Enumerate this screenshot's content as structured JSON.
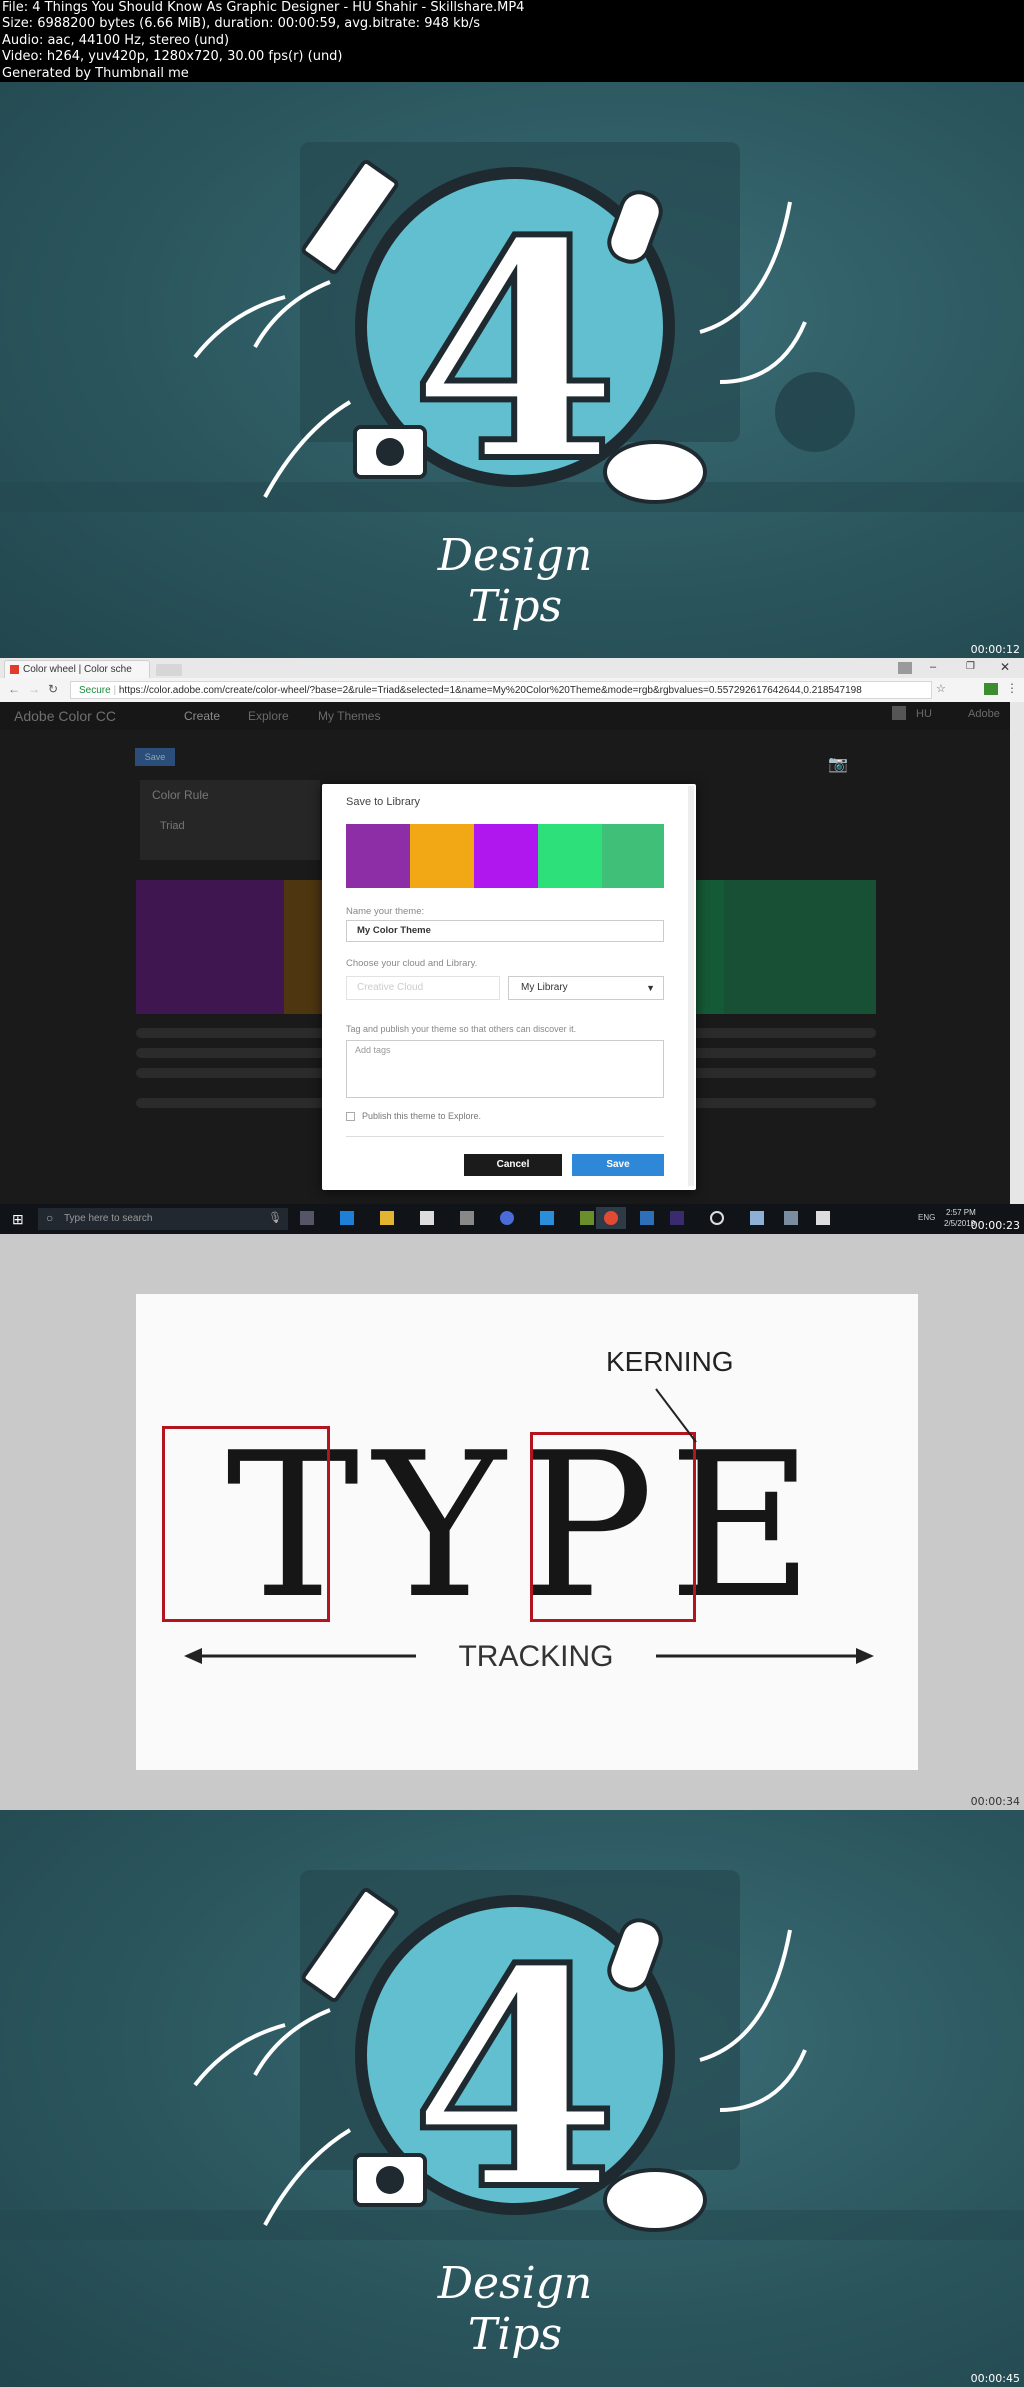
{
  "header": {
    "lines": [
      "File: 4 Things You Should Know As Graphic Designer - HU Shahir - Skillshare.MP4",
      "Size: 6988200 bytes (6.66 MiB), duration: 00:00:59, avg.bitrate: 948 kb/s",
      "Audio: aac, 44100 Hz, stereo (und)",
      "Video: h264, yuv420p, 1280x720, 30.00 fps(r) (und)",
      "Generated by Thumbnail me"
    ]
  },
  "frames": {
    "f1": {
      "numeral": "4",
      "caption": "Design Tips",
      "timestamp": "00:00:12"
    },
    "f2": {
      "tab_title": "Color wheel | Color sche",
      "secure_label": "Secure",
      "url": "https://color.adobe.com/create/color-wheel/?base=2&rule=Triad&selected=1&name=My%20Color%20Theme&mode=rgb&rgbvalues=0.557292617642644,0.218547198",
      "app_name": "Adobe Color CC",
      "nav": [
        "Create",
        "Explore",
        "My Themes"
      ],
      "user_label": "HU",
      "brand_label": "Adobe",
      "save_small": "Save",
      "color_rule_label": "Color Rule",
      "rule_value": "Triad",
      "modal": {
        "title": "Save to Library",
        "swatches": [
          "#8e2ea6",
          "#f2a814",
          "#b017ee",
          "#2ee07a",
          "#3fbf78"
        ],
        "name_label": "Name your theme:",
        "name_value": "My Color Theme",
        "cloud_label": "Choose your cloud and Library.",
        "cloud_value": "Creative Cloud",
        "library_value": "My Library",
        "tag_label": "Tag and publish your theme so that others can discover it.",
        "tag_placeholder": "Add tags",
        "publish_label": "Publish this theme to Explore.",
        "cancel": "Cancel",
        "save": "Save"
      },
      "search_placeholder": "Type here to search",
      "clock_time": "2:57 PM",
      "clock_date": "2/5/2019",
      "lang": "ENG",
      "timestamp": "00:00:23"
    },
    "f3": {
      "word": "TYPE",
      "kerning": "KERNING",
      "tracking": "TRACKING",
      "timestamp": "00:00:34"
    },
    "f4": {
      "numeral": "4",
      "caption": "Design Tips",
      "timestamp": "00:00:45"
    }
  }
}
